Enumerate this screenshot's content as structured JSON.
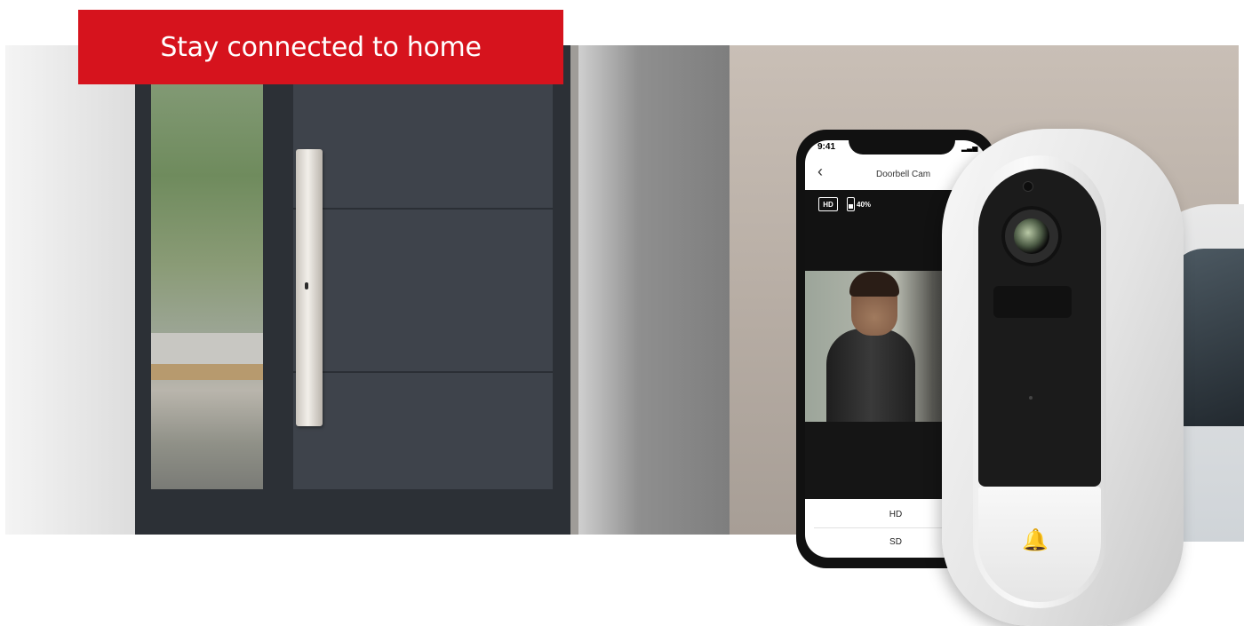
{
  "banner": {
    "text": "Stay connected to home",
    "color": "#d6131d"
  },
  "phone": {
    "status_time": "9:41",
    "nav_title": "Doorbell Cam",
    "back_icon": "chevron-left-icon",
    "quality_badge": "HD",
    "battery_percent": "40%",
    "battery_level": 0.4,
    "options": [
      "HD",
      "SD"
    ]
  },
  "doorbell": {
    "button_icon": "bell-icon"
  }
}
